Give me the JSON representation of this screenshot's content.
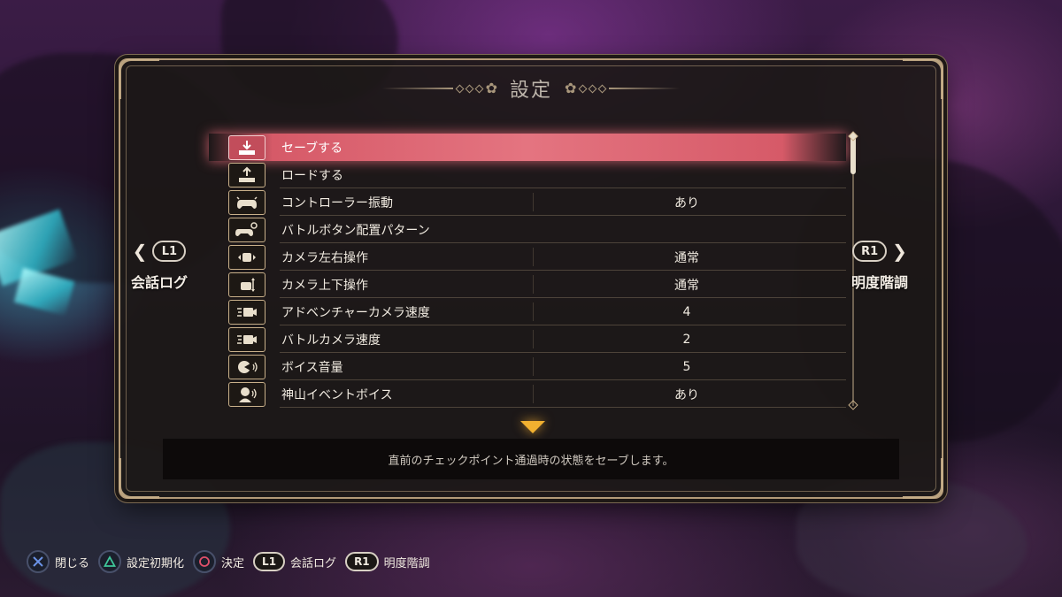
{
  "window": {
    "title": "設定"
  },
  "side_tabs": {
    "left": {
      "button": "L1",
      "label": "会話ログ"
    },
    "right": {
      "button": "R1",
      "label": "明度階調"
    }
  },
  "settings": [
    {
      "icon": "save-icon",
      "label": "セーブする",
      "value": "",
      "selected": true
    },
    {
      "icon": "load-icon",
      "label": "ロードする",
      "value": ""
    },
    {
      "icon": "controller-vibration-icon",
      "label": "コントローラー振動",
      "value": "あり"
    },
    {
      "icon": "controller-settings-icon",
      "label": "バトルボタン配置パターン",
      "value": ""
    },
    {
      "icon": "camera-horizontal-icon",
      "label": "カメラ左右操作",
      "value": "通常"
    },
    {
      "icon": "camera-vertical-icon",
      "label": "カメラ上下操作",
      "value": "通常"
    },
    {
      "icon": "camera-speed-icon",
      "label": "アドベンチャーカメラ速度",
      "value": "4"
    },
    {
      "icon": "camera-speed-icon",
      "label": "バトルカメラ速度",
      "value": "2"
    },
    {
      "icon": "voice-volume-icon",
      "label": "ボイス音量",
      "value": "5"
    },
    {
      "icon": "voice-character-icon",
      "label": "神山イベントボイス",
      "value": "あり"
    }
  ],
  "description": "直前のチェックポイント通過時の状態をセーブします。",
  "hints": [
    {
      "button": "cross",
      "label": "閉じる",
      "color": "#4a7bd8"
    },
    {
      "button": "triangle",
      "label": "設定初期化",
      "color": "#3fc79a"
    },
    {
      "button": "circle",
      "label": "決定",
      "color": "#e0506a"
    },
    {
      "button": "L1",
      "label": "会話ログ"
    },
    {
      "button": "R1",
      "label": "明度階調"
    }
  ],
  "colors": {
    "accent": "#e47480",
    "gold": "#c9b08a",
    "arrow": "#f0b030"
  }
}
